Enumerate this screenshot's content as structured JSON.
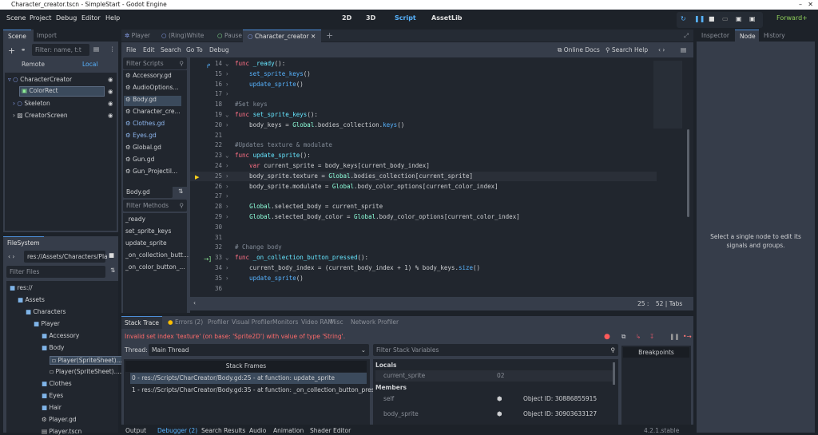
{
  "window": {
    "title": "Character_creator.tscn - SimpleStart - Godot Engine"
  },
  "menu": [
    "Scene",
    "Project",
    "Debug",
    "Editor",
    "Help"
  ],
  "workspaces": [
    "2D",
    "3D",
    "Script",
    "AssetLib"
  ],
  "renderer": "Forward+",
  "scene_dock": {
    "tabs": [
      "Scene",
      "Import"
    ],
    "filter_placeholder": "Filter: name, t:t",
    "remote": "Remote",
    "local": "Local",
    "nodes": [
      "CharacterCreator",
      "ColorRect",
      "Skeleton",
      "CreatorScreen"
    ]
  },
  "filesystem": {
    "tab": "FileSystem",
    "path": "res://Assets/Characters/Pla",
    "filter_placeholder": "Filter Files",
    "items": [
      "res://",
      "Assets",
      "Characters",
      "Player",
      "Accessory",
      "Body",
      "Player(SpriteSheet)...",
      "Player(SpriteSheet)....",
      "Clothes",
      "Eyes",
      "Hair",
      "Player.gd",
      "Player.tscn"
    ]
  },
  "script_tabs": [
    "Player",
    "(Ring)White",
    "Pause",
    "Character_creator"
  ],
  "script_menu": [
    "File",
    "Edit",
    "Search",
    "Go To",
    "Debug"
  ],
  "online_docs": "Online Docs",
  "search_help": "Search Help",
  "scripts": {
    "filter_placeholder": "Filter Scripts",
    "items": [
      "Accessory.gd",
      "AudioOptions...",
      "Body.gd",
      "Character_cre...",
      "Clothes.gd",
      "Eyes.gd",
      "Global.gd",
      "Gun.gd",
      "Gun_Projectil..."
    ],
    "current": "Body.gd",
    "methods_placeholder": "Filter Methods",
    "methods": [
      "_ready",
      "set_sprite_keys",
      "update_sprite",
      "_on_collection_butt...",
      "_on_color_button_..."
    ]
  },
  "code": [
    {
      "n": "14",
      "s": [
        [
          "func ",
          "k"
        ],
        [
          "_ready",
          "f"
        ],
        [
          "():",
          "v"
        ]
      ]
    },
    {
      "n": "15",
      "s": [
        [
          "    set_sprite_keys",
          "c"
        ],
        [
          "()",
          "v"
        ]
      ]
    },
    {
      "n": "16",
      "s": [
        [
          "    update_sprite",
          "c"
        ],
        [
          "()",
          "v"
        ]
      ]
    },
    {
      "n": "17",
      "s": []
    },
    {
      "n": "18",
      "s": [
        [
          "#Set keys",
          "cm"
        ]
      ]
    },
    {
      "n": "19",
      "s": [
        [
          "func ",
          "k"
        ],
        [
          "set_sprite_keys",
          "f"
        ],
        [
          "():",
          "v"
        ]
      ]
    },
    {
      "n": "20",
      "s": [
        [
          "    body_keys = ",
          "v"
        ],
        [
          "Global",
          "g"
        ],
        [
          ".bodies_collection.",
          "v"
        ],
        [
          "keys",
          "c"
        ],
        [
          "()",
          "v"
        ]
      ]
    },
    {
      "n": "21",
      "s": []
    },
    {
      "n": "22",
      "s": [
        [
          "#Updates texture & modulate",
          "cm"
        ]
      ]
    },
    {
      "n": "23",
      "s": [
        [
          "func ",
          "k"
        ],
        [
          "update_sprite",
          "f"
        ],
        [
          "():",
          "v"
        ]
      ]
    },
    {
      "n": "24",
      "s": [
        [
          "    var ",
          "k"
        ],
        [
          "current_sprite = body_keys[current_body_index]",
          "v"
        ]
      ]
    },
    {
      "n": "25",
      "s": [
        [
          "    body_sprite.texture = ",
          "v"
        ],
        [
          "Global",
          "g"
        ],
        [
          ".bodies_collection[current_sprite]",
          "v"
        ]
      ]
    },
    {
      "n": "26",
      "s": [
        [
          "    body_sprite.modulate = ",
          "v"
        ],
        [
          "Global",
          "g"
        ],
        [
          ".body_color_options[current_color_index]",
          "v"
        ]
      ]
    },
    {
      "n": "27",
      "s": []
    },
    {
      "n": "28",
      "s": [
        [
          "    ",
          "v"
        ],
        [
          "Global",
          "g"
        ],
        [
          ".selected_body = current_sprite",
          "v"
        ]
      ]
    },
    {
      "n": "29",
      "s": [
        [
          "    ",
          "v"
        ],
        [
          "Global",
          "g"
        ],
        [
          ".selected_body_color = ",
          "v"
        ],
        [
          "Global",
          "g"
        ],
        [
          ".body_color_options[current_color_index]",
          "v"
        ]
      ]
    },
    {
      "n": "30",
      "s": []
    },
    {
      "n": "31",
      "s": []
    },
    {
      "n": "32",
      "s": [
        [
          "# Change body",
          "cm"
        ]
      ]
    },
    {
      "n": "33",
      "s": [
        [
          "func ",
          "k"
        ],
        [
          "_on_collection_button_pressed",
          "f"
        ],
        [
          "():",
          "v"
        ]
      ]
    },
    {
      "n": "34",
      "s": [
        [
          "    current_body_index = (current_body_index + 1) % body_keys.",
          "v"
        ],
        [
          "size",
          "c"
        ],
        [
          "()",
          "v"
        ]
      ]
    },
    {
      "n": "35",
      "s": [
        [
          "    update_sprite",
          "c"
        ],
        [
          "()",
          "v"
        ]
      ]
    },
    {
      "n": "36",
      "s": []
    }
  ],
  "status": {
    "line": "25",
    "col": "52",
    "indent": "Tabs"
  },
  "debugger": {
    "tabs": [
      "Stack Trace",
      "Errors (2)",
      "Profiler",
      "Visual Profiler",
      "Monitors",
      "Video RAM",
      "Misc",
      "Network Profiler"
    ],
    "error": "Invalid set index 'texture' (on base: 'Sprite2D') with value of type 'String'.",
    "thread_label": "Thread:",
    "thread": "Main Thread",
    "frames_header": "Stack Frames",
    "frames": [
      "0 - res://Scripts/CharCreator/Body.gd:25 - at function: update_sprite",
      "1 - res://Scripts/CharCreator/Body.gd:35 - at function: _on_collection_button_press..."
    ],
    "filter_vars": "Filter Stack Variables",
    "locals": "Locals",
    "members": "Members",
    "vars": [
      {
        "name": "current_sprite",
        "value": "02"
      },
      {
        "name": "self",
        "value": "Object ID: 30886855915"
      },
      {
        "name": "body_sprite",
        "value": "Object ID: 30903633127"
      }
    ],
    "breakpoints": "Breakpoints"
  },
  "bottom_tabs": [
    "Output",
    "Debugger (2)",
    "Search Results",
    "Audio",
    "Animation",
    "Shader Editor"
  ],
  "version": "4.2.1.stable",
  "right_dock": {
    "tabs": [
      "Inspector",
      "Node",
      "History"
    ],
    "message": "Select a single node to edit its signals and groups."
  }
}
